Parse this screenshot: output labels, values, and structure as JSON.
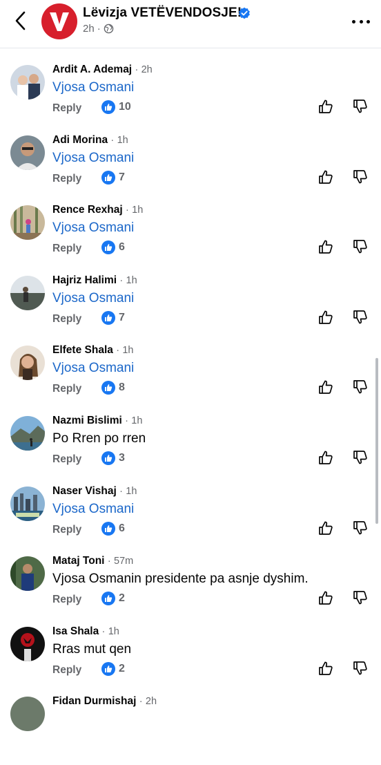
{
  "header": {
    "page_name": "Lëvizja VETËVENDOSJE!",
    "post_time": "2h",
    "separator": "·",
    "colors": {
      "brand": "#d71f2c",
      "verified": "#1877f2"
    }
  },
  "comment_time_separator": "·",
  "comments": [
    {
      "name": "Ardit A. Ademaj",
      "time": "2h",
      "text": "Vjosa Osmani",
      "mention": true,
      "reply": "Reply",
      "likes": "10"
    },
    {
      "name": "Adi Morina",
      "time": "1h",
      "text": "Vjosa Osmani",
      "mention": true,
      "reply": "Reply",
      "likes": "7"
    },
    {
      "name": "Rence Rexhaj",
      "time": "1h",
      "text": "Vjosa Osmani",
      "mention": true,
      "reply": "Reply",
      "likes": "6"
    },
    {
      "name": "Hajriz Halimi",
      "time": "1h",
      "text": "Vjosa Osmani",
      "mention": true,
      "reply": "Reply",
      "likes": "7"
    },
    {
      "name": "Elfete Shala",
      "time": "1h",
      "text": "Vjosa Osmani",
      "mention": true,
      "reply": "Reply",
      "likes": "8"
    },
    {
      "name": "Nazmi Bislimi",
      "time": "1h",
      "text": "Po Rren po rren",
      "mention": false,
      "reply": "Reply",
      "likes": "3"
    },
    {
      "name": "Naser Vishaj",
      "time": "1h",
      "text": "Vjosa Osmani",
      "mention": true,
      "reply": "Reply",
      "likes": "6"
    },
    {
      "name": "Mataj Toni",
      "time": "57m",
      "text": "Vjosa Osmanin presidente pa asnje dyshim.",
      "mention": false,
      "reply": "Reply",
      "likes": "2"
    },
    {
      "name": "Isa Shala",
      "time": "1h",
      "text": "Rras mut qen",
      "mention": false,
      "reply": "Reply",
      "likes": "2"
    },
    {
      "name": "Fidan Durmishaj",
      "time": "2h",
      "text": "",
      "mention": false,
      "reply": "",
      "likes": ""
    }
  ],
  "icons": {
    "back": "chevron-left-icon",
    "more": "more-options-icon",
    "audience": "globe-icon",
    "like_badge": "thumbs-up-badge-icon",
    "upvote": "thumbs-up-outline-icon",
    "downvote": "thumbs-down-outline-icon"
  },
  "colors": {
    "mention": "#1b67c9",
    "like_badge": "#1877f2",
    "muted_text": "#65676b"
  }
}
